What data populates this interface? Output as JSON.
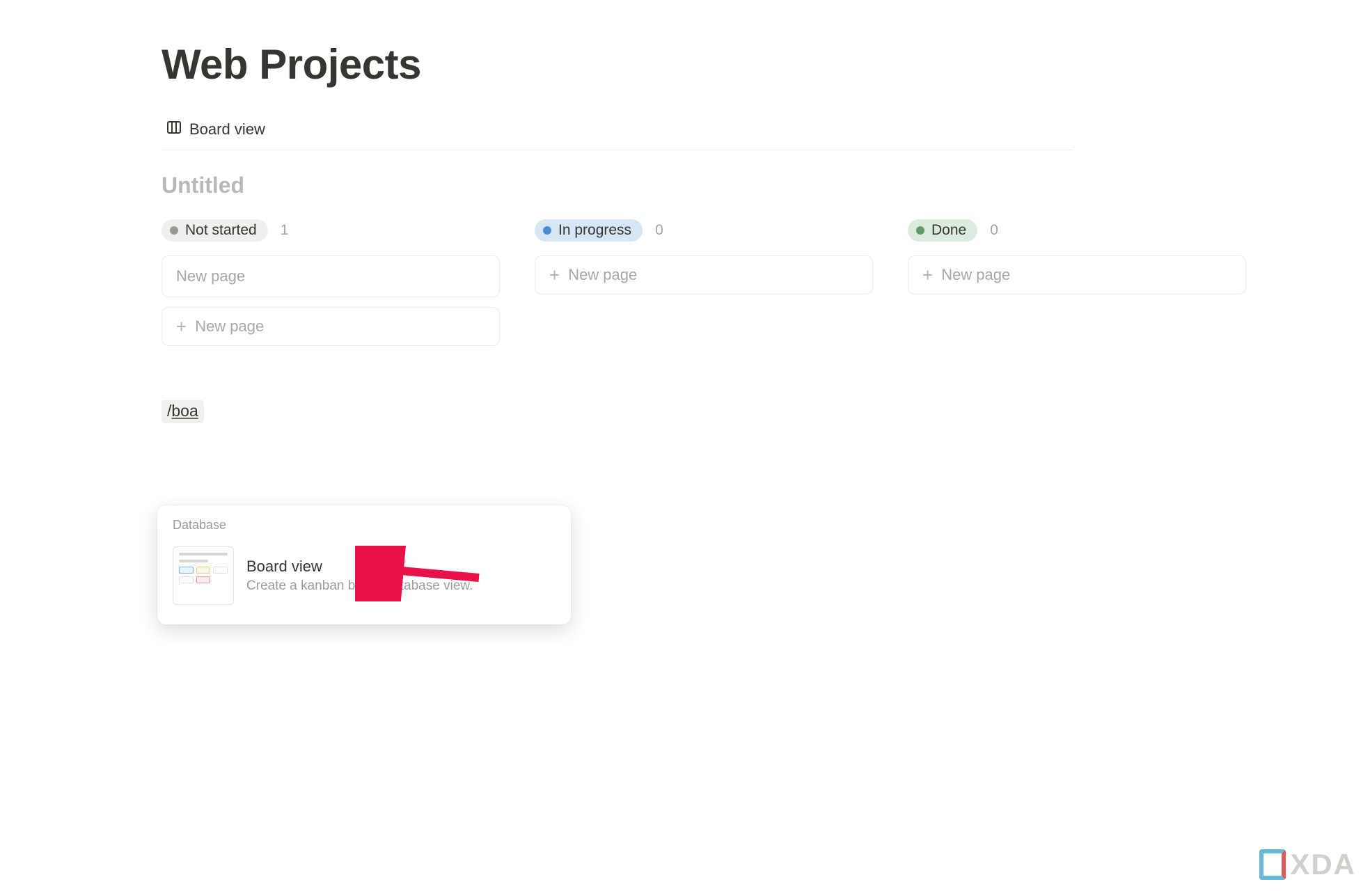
{
  "page": {
    "title": "Web Projects"
  },
  "view_tab": {
    "label": "Board view"
  },
  "database": {
    "title": "Untitled"
  },
  "columns": [
    {
      "status": "Not started",
      "count": "1",
      "pill_class": "pill-not-started",
      "has_placeholder_card": true
    },
    {
      "status": "In progress",
      "count": "0",
      "pill_class": "pill-in-progress",
      "has_placeholder_card": false
    },
    {
      "status": "Done",
      "count": "0",
      "pill_class": "pill-done",
      "has_placeholder_card": false
    }
  ],
  "card_placeholder": "New page",
  "new_page_label": "New page",
  "slash_input": {
    "prefix": "/",
    "query": "boa"
  },
  "popup": {
    "section": "Database",
    "item": {
      "title": "Board view",
      "description": "Create a kanban board database view."
    }
  },
  "watermark": "XDA"
}
